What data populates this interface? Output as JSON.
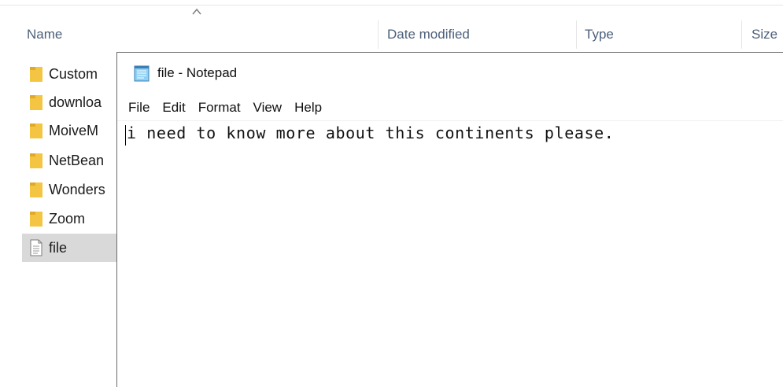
{
  "explorer": {
    "columns": {
      "name": "Name",
      "date_modified": "Date modified",
      "type": "Type",
      "size": "Size"
    },
    "files": [
      {
        "name": "Custom",
        "icon": "folder-icon"
      },
      {
        "name": "downloa",
        "icon": "folder-icon"
      },
      {
        "name": "MoiveM",
        "icon": "folder-icon"
      },
      {
        "name": "NetBean",
        "icon": "folder-icon"
      },
      {
        "name": "Wonders",
        "icon": "folder-icon"
      },
      {
        "name": "Zoom",
        "icon": "folder-icon"
      },
      {
        "name": "file",
        "icon": "text-file-icon",
        "selected": true
      }
    ]
  },
  "notepad": {
    "title": "file - Notepad",
    "menu": [
      "File",
      "Edit",
      "Format",
      "View",
      "Help"
    ],
    "content": "i need to know more about this continents please."
  },
  "colors": {
    "folder": "#f4c542",
    "selection": "#d9d9d9",
    "header_text": "#4c607a"
  }
}
